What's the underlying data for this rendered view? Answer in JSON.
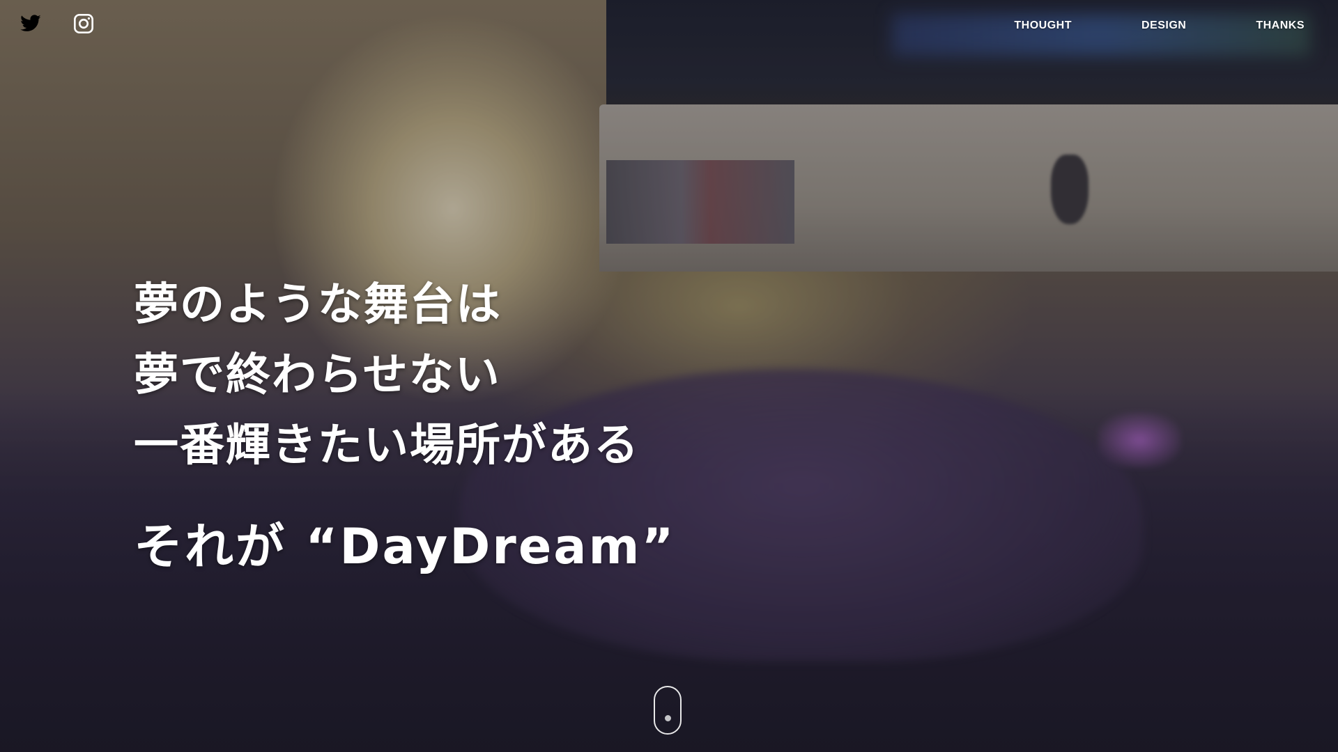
{
  "social": {
    "twitter_icon": "twitter-bird-icon",
    "instagram_icon": "instagram-camera-icon"
  },
  "nav": {
    "items": [
      {
        "label": "THOUGHT"
      },
      {
        "label": "DESIGN"
      },
      {
        "label": "THANKS"
      }
    ]
  },
  "hero": {
    "lines": [
      "夢のような舞台は",
      "夢で終わらせない",
      "一番輝きたい場所がある"
    ],
    "tagline": "それが “DayDream”"
  },
  "scroll_indicator": {
    "icon": "mouse-scroll-icon"
  },
  "colors": {
    "text": "#ffffff",
    "overlay": "#14121c"
  }
}
